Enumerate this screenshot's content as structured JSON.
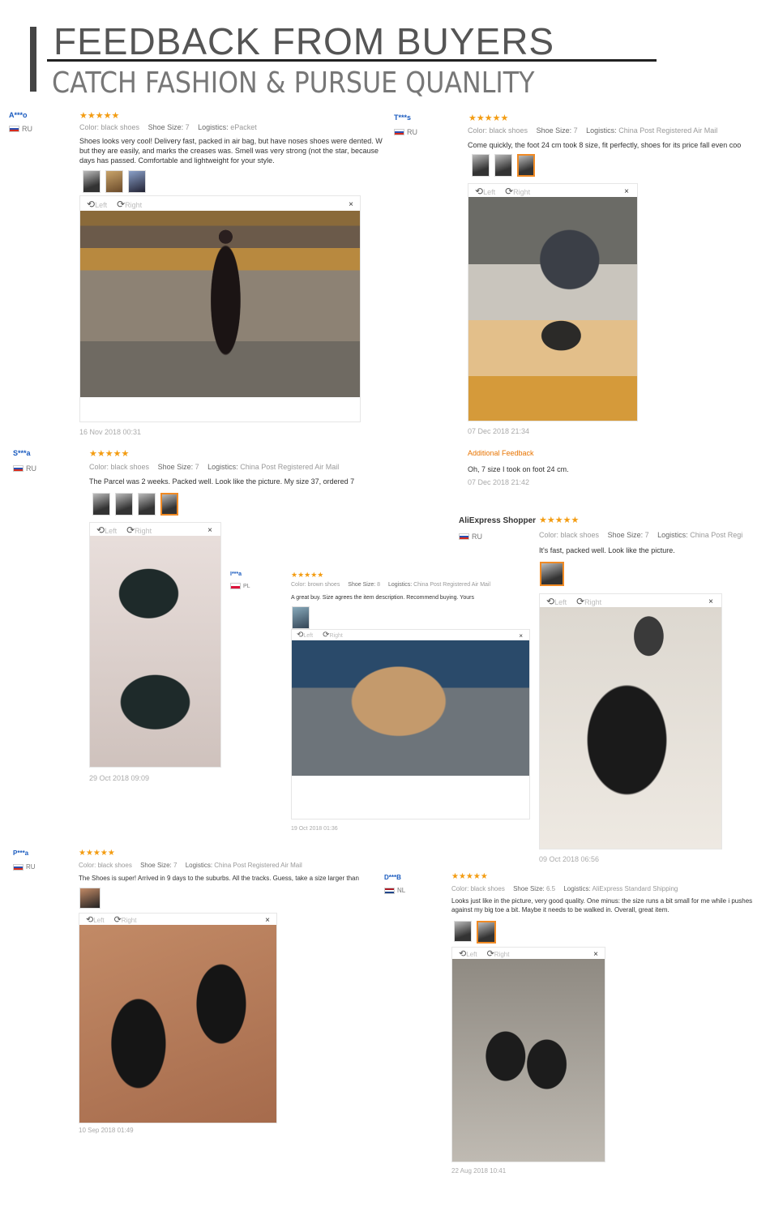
{
  "header": {
    "title": "FEEDBACK FROM BUYERS",
    "subtitle": "CATCH FASHION & PURSUE QUANLITY"
  },
  "controls": {
    "left": "Left",
    "right": "Right",
    "close": "×"
  },
  "colors": {
    "user": "#1a5bbf",
    "stars": "#f39c12",
    "additional": "#e87400",
    "selected_thumb": "#f08a24"
  },
  "reviews": [
    {
      "user": "A***o",
      "country": "RU",
      "stars": "★★★★★",
      "color_label": "Color:",
      "color": "black shoes",
      "size_label": "Shoe Size:",
      "size": "7",
      "log_label": "Logistics:",
      "logistics": "ePacket",
      "text": "Shoes looks very cool! Delivery fast, packed in air bag, but have noses shoes were dented. W but they are easily, and marks the creases was. Smell was very strong (not the star, because days has passed. Comfortable and lightweight for your style.",
      "date": "16 Nov 2018 00:31"
    },
    {
      "user": "T***s",
      "country": "RU",
      "stars": "★★★★★",
      "color_label": "Color:",
      "color": "black shoes",
      "size_label": "Shoe Size:",
      "size": "7",
      "log_label": "Logistics:",
      "logistics": "China Post Registered Air Mail",
      "text": "Come quickly, the foot 24 cm took 8 size, fit perfectly, shoes for its price fall even coo",
      "date": "07 Dec 2018 21:34",
      "additional_label": "Additional Feedback",
      "additional_text": "Oh, 7 size I took on foot 24 cm.",
      "additional_date": "07 Dec 2018 21:42"
    },
    {
      "user": "S***a",
      "country": "RU",
      "stars": "★★★★★",
      "color_label": "Color:",
      "color": "black shoes",
      "size_label": "Shoe Size:",
      "size": "7",
      "log_label": "Logistics:",
      "logistics": "China Post Registered Air Mail",
      "text": "The Parcel was 2 weeks. Packed well. Look like the picture. My size 37, ordered 7",
      "date": "29 Oct 2018 09:09"
    },
    {
      "user": "I***a",
      "country": "PL",
      "stars": "★★★★★",
      "color_label": "Color:",
      "color": "brown shoes",
      "size_label": "Shoe Size:",
      "size": "8",
      "log_label": "Logistics:",
      "logistics": "China Post Registered Air Mail",
      "text": "A great buy. Size agrees the item description. Recommend buying. Yours",
      "date": "19 Oct 2018 01:36"
    },
    {
      "user": "AliExpress Shopper",
      "country": "RU",
      "stars": "★★★★★",
      "color_label": "Color:",
      "color": "black shoes",
      "size_label": "Shoe Size:",
      "size": "7",
      "log_label": "Logistics:",
      "logistics": "China Post Regi",
      "text": "It's fast, packed well. Look like the picture.",
      "date": "09 Oct 2018 06:56"
    },
    {
      "user": "P***a",
      "country": "RU",
      "stars": "★★★★★",
      "color_label": "Color:",
      "color": "black shoes",
      "size_label": "Shoe Size:",
      "size": "7",
      "log_label": "Logistics:",
      "logistics": "China Post Registered Air Mail",
      "text": "The Shoes is super! Arrived in 9 days to the suburbs. All the tracks. Guess, take a size larger than",
      "date": "10 Sep 2018 01:49"
    },
    {
      "user": "D***B",
      "country": "NL",
      "stars": "★★★★★",
      "color_label": "Color:",
      "color": "black shoes",
      "size_label": "Shoe Size:",
      "size": "6.5",
      "log_label": "Logistics:",
      "logistics": "AliExpress Standard Shipping",
      "text": "Looks just like in the picture, very good quality. One minus: the size runs a bit small for me while i pushes against my big toe a bit. Maybe it needs to be walked in. Overall, great item.",
      "date": "22 Aug 2018 10:41"
    }
  ]
}
